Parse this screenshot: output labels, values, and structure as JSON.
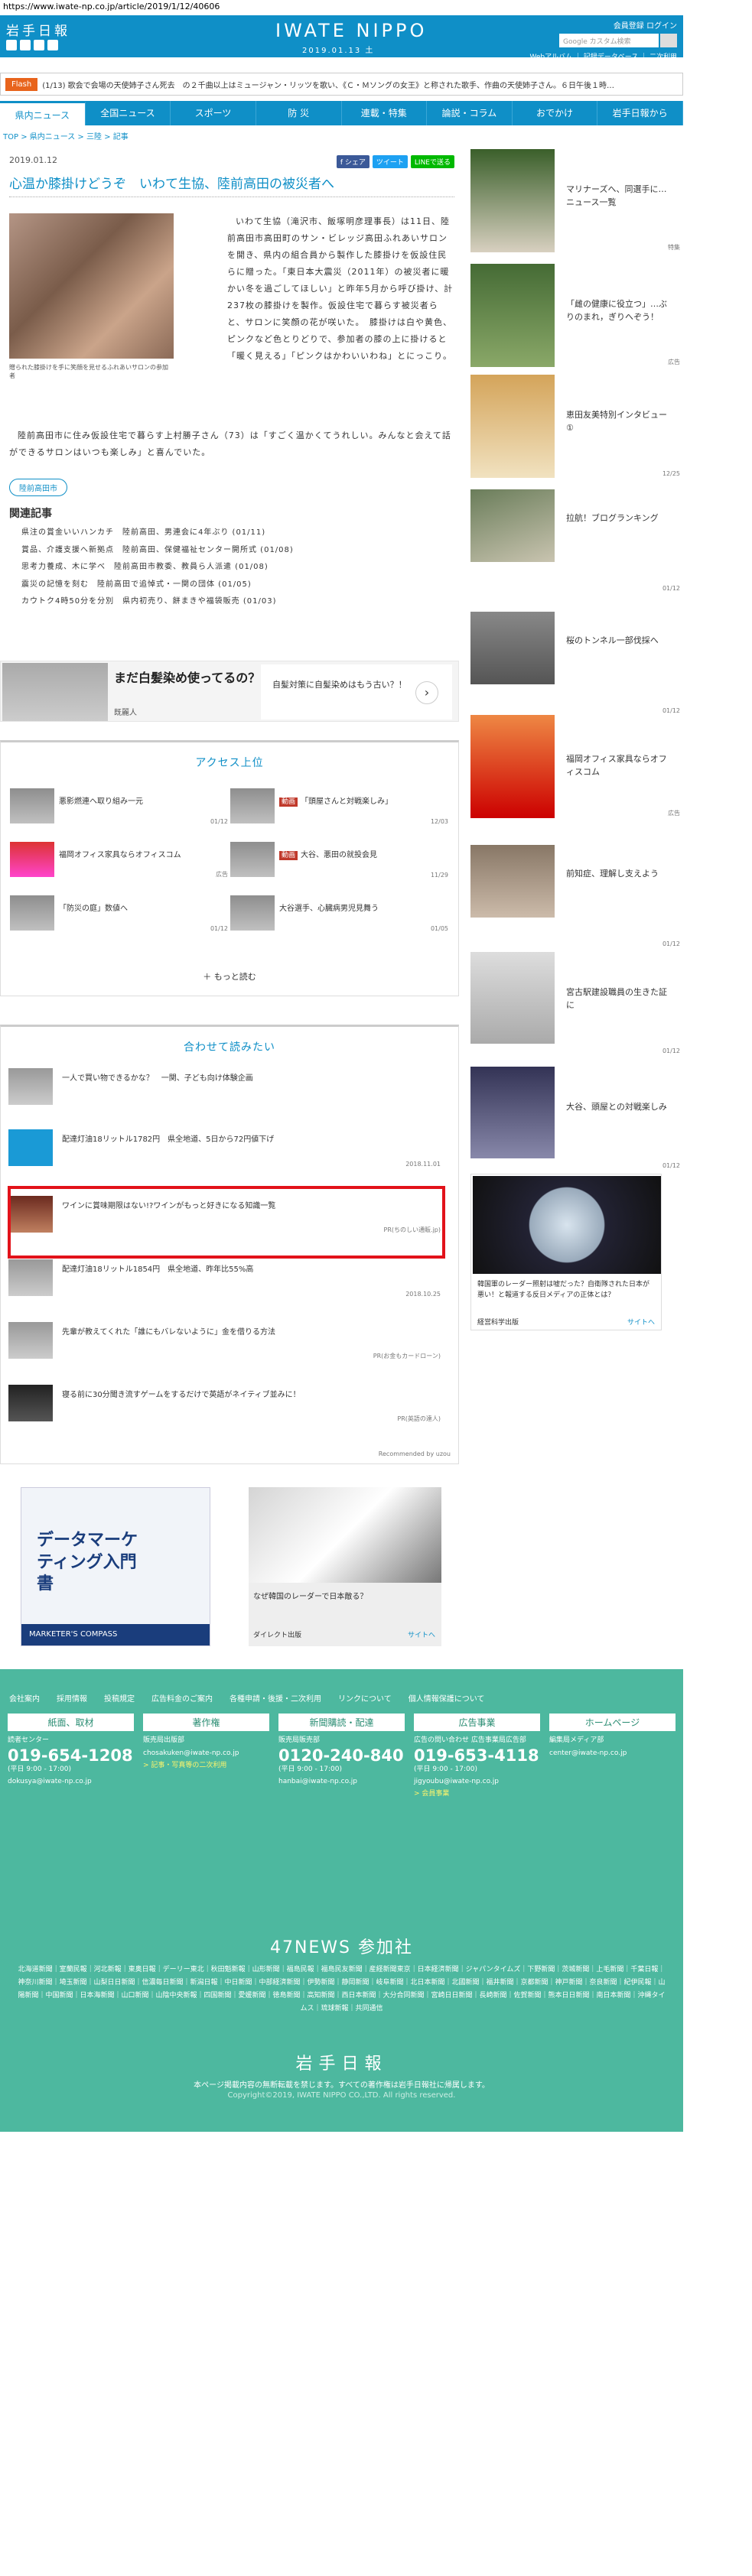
{
  "url": "https://www.iwate-np.co.jp/article/2019/1/12/40606",
  "header": {
    "logo": "岩手日報",
    "brand": "IWATE NIPPO",
    "date": "2019.01.13 土",
    "links": "会員登録 ログイン",
    "search_placeholder": "Google カスタム検索",
    "sublinks": "Webアルバム ｜ 記録データベース ｜ 二次利用"
  },
  "flash": {
    "tag": "Flash",
    "text": "(1/13) 歌会で会場の天使姉子さん死去　の２千曲以上はミュージャン・リッツを歌い、《Ｃ・Ｍソングの女王》と称された歌手、作曲の天使姉子さん。６日午後１時…"
  },
  "nav": [
    "県内ニュース",
    "全国ニュース",
    "スポーツ",
    "防 災",
    "連載・特集",
    "論説・コラム",
    "おでかけ",
    "岩手日報から"
  ],
  "breadcrumb": "TOP > 県内ニュース > 三陸 > 記事",
  "article": {
    "date": "2019.01.12",
    "share": [
      "f シェア",
      "ツイート",
      "LINEで送る"
    ],
    "title": "心温か膝掛けどうぞ　いわて生協、陸前高田の被災者へ",
    "caption": "贈られた膝掛けを手に笑顔を見せるふれあいサロンの参加者",
    "body1": "いわて生協（滝沢市、飯塚明彦理事長）は11日、陸前高田市高田町のサン・ビレッジ高田ふれあいサロンを開き、県内の組合員から製作した膝掛けを仮設住民らに贈った。「東日本大震災（2011年）の被災者に暖かい冬を過ごしてほしい」と昨年5月から呼び掛け、計237枚の膝掛けを製作。仮設住宅で暮らす被災者らと、サロンに笑顔の花が咲いた。　膝掛けは白や黄色、ピンクなど色とりどりで、参加者の膝の上に掛けると「暖く見える」「ピンクはかわいいわね」とにっこり。",
    "body2": "陸前高田市に住み仮設住宅で暮らす上村勝子さん（73）は「すごく温かくてうれしい。みんなと会えて話ができるサロンはいつも楽しみ」と喜んでいた。",
    "tag": "陸前高田市",
    "related_heading": "関連記事",
    "related": [
      "県注の賞金いいハンカチ　陸前高田、男連会に4年ぶり (01/11)",
      "賞品、介護支援へ新拠点　陸前高田、保健福祉センター開所式 (01/08)",
      "思考力養成、木に学べ　陸前高田市教委、教員ら人派遣 (01/08)",
      "震災の記憶を刻む　陸前高田で追悼式・一関の団体 (01/05)",
      "カウトク4時50分を分別　県内初売り、餅まきや福袋販売 (01/03)"
    ]
  },
  "ad1": {
    "title": "まだ白髪染め使ってるの？",
    "sponsor": "既麗人",
    "right": "自髪対策に自髪染めはもう古い？！",
    "arrow": "›"
  },
  "access": {
    "heading": "アクセス上位",
    "items": [
      {
        "title": "悪影燃連へ取り組み一元",
        "date": "01/12",
        "badge": ""
      },
      {
        "title": "「頭屋さんと対戦楽しみ」",
        "date": "12/03",
        "badge": "動画"
      },
      {
        "title": "福岡オフィス家具ならオフィスコム",
        "date": "広告",
        "badge": ""
      },
      {
        "title": "大谷、悪田の就投会見",
        "date": "11/29",
        "badge": "動画"
      },
      {
        "title": "「防災の庭」数値へ",
        "date": "01/12",
        "badge": ""
      },
      {
        "title": "大谷選手、心臓病男児見舞う",
        "date": "01/05",
        "badge": ""
      }
    ],
    "more": "もっと読む"
  },
  "together": {
    "heading": "合わせて読みたい",
    "items": [
      {
        "title": "一人で買い物できるかな？　一関、子ども向け体験企画",
        "date": ""
      },
      {
        "title": "配達灯油18リットル1782円　県全地道、5日から72円値下げ",
        "date": "2018.11.01"
      },
      {
        "title": "ワインに賞味期限はない!?ワインがもっと好きになる知識一覧",
        "date": "PR(ちのしい通販.jp)"
      },
      {
        "title": "配達灯油18リットル1854円　県全地道、昨年比55%高",
        "date": "2018.10.25"
      },
      {
        "title": "先輩が教えてくれた「誰にもバレないように」金を借りる方法",
        "date": "PR(お金もカードローン)"
      },
      {
        "title": "寝る前に30分聞き流すゲームをするだけで英語がネイティブ並みに！",
        "date": "PR(英語の達人)"
      }
    ],
    "recommended": "Recommended by uzou"
  },
  "ads2": {
    "a_title": "データマーケティング入門書",
    "a_footer": "MARKETER'S COMPASS",
    "b_title": "なぜ韓国のレーダーで日本敵る？",
    "b_sponsor": "ダイレクト出版",
    "b_more": "サイトへ"
  },
  "sidebar": {
    "items": [
      {
        "title": "マリナーズへ、同選手に…ニュース一覧",
        "date": "特集"
      },
      {
        "title": "「雌の健康に役立つ」…ぶりのまれ，ぎりへぞう！",
        "date": "広告"
      },
      {
        "title": "恵田友美特別インタビュー①",
        "date": "12/25"
      },
      {
        "title": "拉航！ブログランキング",
        "date": "01/12"
      },
      {
        "title": "桜のトンネル一部伐採へ",
        "date": "01/12"
      },
      {
        "title": "福岡オフィス家具ならオフィスコム",
        "date": "広告"
      },
      {
        "title": "前知症、理解し支えよう",
        "date": "01/12"
      },
      {
        "title": "宮古駅建設職員の生きた証に",
        "date": "01/12"
      },
      {
        "title": "大谷、頭屋との対戦楽しみ",
        "date": "01/12"
      }
    ],
    "ad": {
      "text": "韓国軍のレーダー照射は嘘だった？自衛隊された日本が悪い！と報道する反日メディアの正体とは？",
      "sponsor": "経営科学出版",
      "more": "サイトへ"
    }
  },
  "footer": {
    "links": [
      "会社案内",
      "採用情報",
      "投稿規定",
      "広告料金のご案内",
      "各種申請・後援・二次利用",
      "リンクについて",
      "個人情報保護について"
    ],
    "cols": [
      {
        "head": "紙面、取材",
        "desc": "読者センター",
        "phone": "019-654-1208",
        "hours": "(平日 9:00 - 17:00)",
        "email": "dokusya@iwate-np.co.jp",
        "note": ""
      },
      {
        "head": "著作権",
        "desc": "販売局出版部",
        "phone": "",
        "hours": "",
        "email": "chosakuken@iwate-np.co.jp",
        "note": "> 記事・写真等の二次利用"
      },
      {
        "head": "新聞購読・配達",
        "desc": "販売局販売部",
        "phone": "0120-240-840",
        "hours": "(平日 9:00 - 17:00)",
        "email": "hanbai@iwate-np.co.jp",
        "note": ""
      },
      {
        "head": "広告事業",
        "desc": "広告の問い合わせ 広告事業局広告部",
        "phone": "019-653-4118",
        "hours": "(平日 9:00 - 17:00)",
        "email": "jigyoubu@iwate-np.co.jp",
        "note": "> 会員事業"
      },
      {
        "head": "ホームページ",
        "desc": "編集局メディア部",
        "phone": "",
        "hours": "",
        "email": "center@iwate-np.co.jp",
        "note": ""
      }
    ],
    "news47": "47NEWS 参加社",
    "papers": "北海道新聞｜室蘭民報｜河北新報｜東奥日報｜デーリー東北｜秋田魁新報｜山形新聞｜福島民報｜福島民友新聞｜産経新聞東京｜日本経済新聞｜ジャパンタイムズ｜下野新聞｜茨城新聞｜上毛新聞｜千葉日報｜神奈川新聞｜埼玉新聞｜山梨日日新聞｜信濃毎日新聞｜新潟日報｜中日新聞｜中部経済新聞｜伊勢新聞｜静岡新聞｜岐阜新聞｜北日本新聞｜北國新聞｜福井新聞｜京都新聞｜神戸新聞｜奈良新聞｜紀伊民報｜山陽新聞｜中国新聞｜日本海新聞｜山口新聞｜山陰中央新報｜四国新聞｜愛媛新聞｜徳島新聞｜高知新聞｜西日本新聞｜大分合同新聞｜宮崎日日新聞｜長崎新聞｜佐賀新聞｜熊本日日新聞｜南日本新聞｜沖縄タイムス｜琉球新報｜共同通信",
    "logo": "岩手日報",
    "copy1": "本ページ掲載内容の無断転載を禁じます。すべての著作権は岩手日報社に帰属します。",
    "copy2": "Copyright©2019, IWATE NIPPO CO.,LTD. All rights reserved."
  }
}
